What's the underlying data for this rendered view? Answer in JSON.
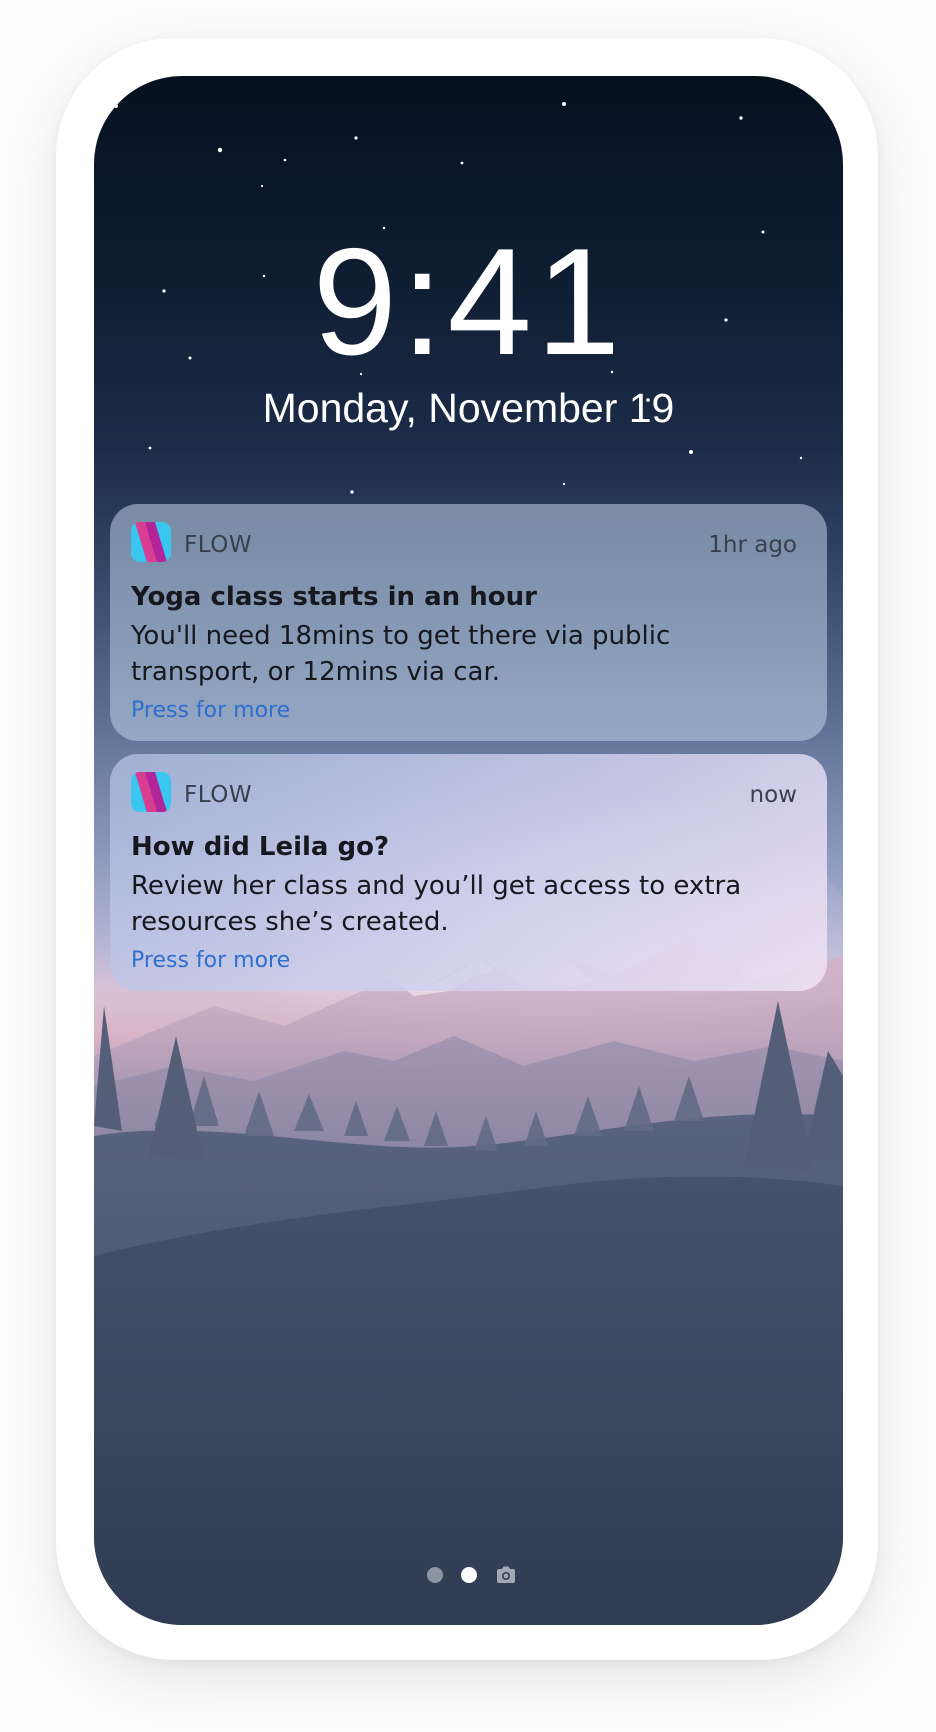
{
  "lockscreen": {
    "time": "9:41",
    "date": "Monday, November 19"
  },
  "notifications": [
    {
      "app_name": "FLOW",
      "timestamp": "1hr ago",
      "title": "Yoga class starts in an hour",
      "body": "You'll need 18mins to get there via public transport, or 12mins via car.",
      "action": "Press for more",
      "icon": "flow-app-icon"
    },
    {
      "app_name": "FLOW",
      "timestamp": "now",
      "title": "How did Leila go?",
      "body": "Review her class and you’ll get access to extra resources she’s created.",
      "action": "Press for more",
      "icon": "flow-app-icon"
    }
  ],
  "page_indicator": {
    "pages": 2,
    "active_page": 2,
    "trailing_icon": "camera-icon"
  },
  "colors": {
    "action_link": "#2f6fcf",
    "icon_cyan": "#39c6ef",
    "icon_magenta": "#b1249a"
  }
}
